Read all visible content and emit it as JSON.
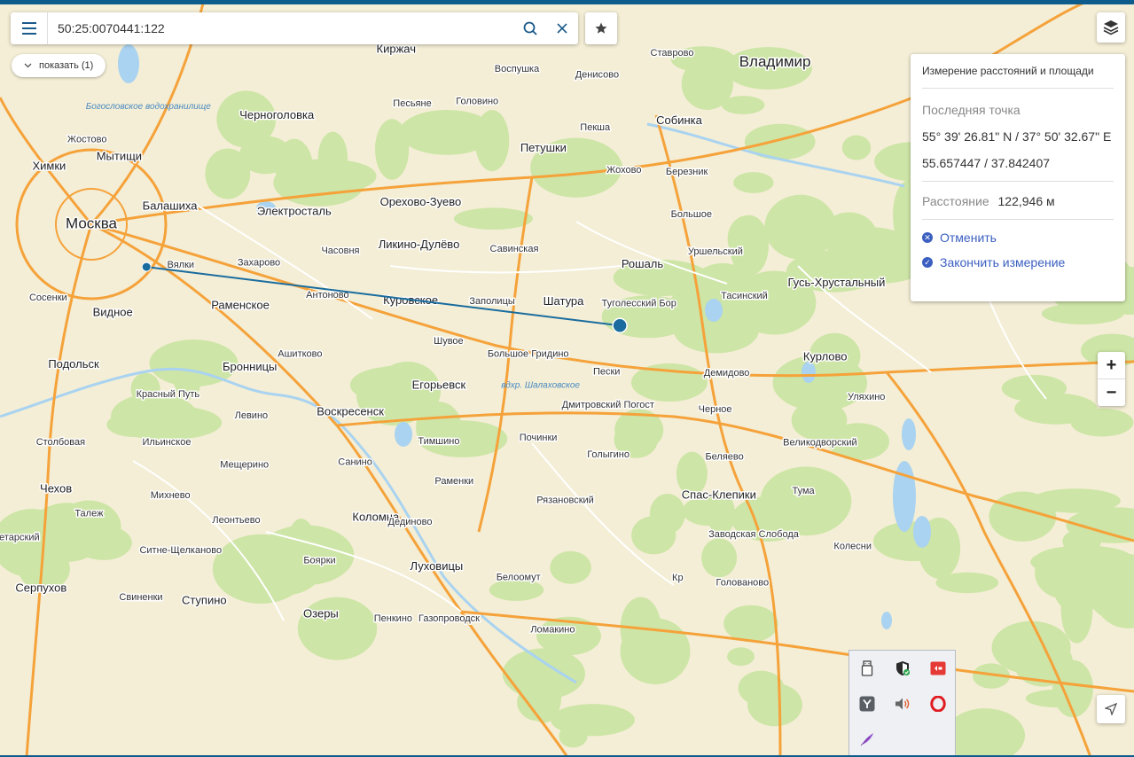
{
  "search": {
    "value": "50:25:0070441:122"
  },
  "show_button": {
    "label": "показать (1)"
  },
  "measure_panel": {
    "title": "Измерение расстояний и площади",
    "last_point_label": "Последняя точка",
    "coords_dms": "55° 39' 26.81\" N / 37° 50' 32.67\" E",
    "coords_decimal": "55.657447 / 37.842407",
    "distance_label": "Расстояние",
    "distance_value": "122,946 м",
    "cancel_label": "Отменить",
    "finish_label": "Закончить измерение"
  },
  "zoom": {
    "plus": "+",
    "minus": "−"
  },
  "map": {
    "colors": {
      "land": "#f4eed6",
      "forest": "#cde5a6",
      "water": "#a9d3f0",
      "road_major": "#f5a23a",
      "road_minor": "#ffffff",
      "measure_line": "#1a6c9e"
    },
    "cities_major": [
      {
        "name": "Москва",
        "lat": 55.7558,
        "lon": 37.6173
      },
      {
        "name": "Владимир",
        "lat": 56.129,
        "lon": 40.407
      }
    ],
    "cities": [
      {
        "name": "Химки",
        "lat": 55.889,
        "lon": 37.445
      },
      {
        "name": "Мытищи",
        "lat": 55.911,
        "lon": 37.731
      },
      {
        "name": "Балашиха",
        "lat": 55.796,
        "lon": 37.938
      },
      {
        "name": "Электросталь",
        "lat": 55.784,
        "lon": 38.445
      },
      {
        "name": "Черноголовка",
        "lat": 56.006,
        "lon": 38.374
      },
      {
        "name": "Орехово-Зуево",
        "lat": 55.806,
        "lon": 38.961
      },
      {
        "name": "Ликино-Дулёво",
        "lat": 55.708,
        "lon": 38.954
      },
      {
        "name": "Петушки",
        "lat": 55.93,
        "lon": 39.462
      },
      {
        "name": "Собинка",
        "lat": 55.994,
        "lon": 40.016
      },
      {
        "name": "Рошаль",
        "lat": 55.663,
        "lon": 39.866
      },
      {
        "name": "Гусь-Хрустальный",
        "lat": 55.62,
        "lon": 40.658
      },
      {
        "name": "Раменское",
        "lat": 55.567,
        "lon": 38.225
      },
      {
        "name": "Видное",
        "lat": 55.551,
        "lon": 37.705
      },
      {
        "name": "Куровское",
        "lat": 55.579,
        "lon": 38.92
      },
      {
        "name": "Шатура",
        "lat": 55.577,
        "lon": 39.544
      },
      {
        "name": "Подольск",
        "lat": 55.431,
        "lon": 37.545
      },
      {
        "name": "Бронницы",
        "lat": 55.425,
        "lon": 38.264
      },
      {
        "name": "Егорьевск",
        "lat": 55.383,
        "lon": 39.035
      },
      {
        "name": "Курлово",
        "lat": 55.449,
        "lon": 40.612
      },
      {
        "name": "Воскресенск",
        "lat": 55.322,
        "lon": 38.674
      },
      {
        "name": "Чехов",
        "lat": 55.144,
        "lon": 37.473
      },
      {
        "name": "Спас-Клепики",
        "lat": 55.13,
        "lon": 40.178
      },
      {
        "name": "Коломна",
        "lat": 55.079,
        "lon": 38.778
      },
      {
        "name": "Серпухов",
        "lat": 54.915,
        "lon": 37.412
      },
      {
        "name": "Луховицы",
        "lat": 54.965,
        "lon": 39.026
      },
      {
        "name": "Ступино",
        "lat": 54.886,
        "lon": 38.078
      },
      {
        "name": "Озеры",
        "lat": 54.856,
        "lon": 38.554
      },
      {
        "name": "Киржач",
        "lat": 56.158,
        "lon": 38.861
      }
    ],
    "villages": [
      {
        "name": "Жостово",
        "lat": 55.951,
        "lon": 37.6
      },
      {
        "name": "Песьяне",
        "lat": 56.034,
        "lon": 38.927
      },
      {
        "name": "Головино",
        "lat": 56.039,
        "lon": 39.192
      },
      {
        "name": "Воспушка",
        "lat": 56.113,
        "lon": 39.354
      },
      {
        "name": "Денисово",
        "lat": 56.1,
        "lon": 39.681
      },
      {
        "name": "Ставрово",
        "lat": 56.15,
        "lon": 39.987
      },
      {
        "name": "Пекша",
        "lat": 55.978,
        "lon": 39.673
      },
      {
        "name": "Жохово",
        "lat": 55.88,
        "lon": 39.791
      },
      {
        "name": "Березник",
        "lat": 55.876,
        "lon": 40.047
      },
      {
        "name": "Большое",
        "lat": 55.778,
        "lon": 40.066
      },
      {
        "name": "Часовня",
        "lat": 55.694,
        "lon": 38.634
      },
      {
        "name": "Савинская",
        "lat": 55.698,
        "lon": 39.343
      },
      {
        "name": "Вялки",
        "lat": 55.662,
        "lon": 37.982
      },
      {
        "name": "Захарово",
        "lat": 55.667,
        "lon": 38.301
      },
      {
        "name": "Сосенки",
        "lat": 55.586,
        "lon": 37.441
      },
      {
        "name": "Антоново",
        "lat": 55.592,
        "lon": 38.581
      },
      {
        "name": "Заполицы",
        "lat": 55.578,
        "lon": 39.253
      },
      {
        "name": "Туголесский Бор",
        "lat": 55.573,
        "lon": 39.852
      },
      {
        "name": "Тасинский",
        "lat": 55.59,
        "lon": 40.282
      },
      {
        "name": "Шувое",
        "lat": 55.486,
        "lon": 39.075
      },
      {
        "name": "Ашитково",
        "lat": 55.456,
        "lon": 38.469
      },
      {
        "name": "Большое Гридино",
        "lat": 55.456,
        "lon": 39.4
      },
      {
        "name": "Пески",
        "lat": 55.415,
        "lon": 39.72
      },
      {
        "name": "Демидово",
        "lat": 55.412,
        "lon": 40.21
      },
      {
        "name": "Красный Путь",
        "lat": 55.363,
        "lon": 37.93
      },
      {
        "name": "Дмитровский Погост",
        "lat": 55.338,
        "lon": 39.726
      },
      {
        "name": "Черное",
        "lat": 55.328,
        "lon": 40.163
      },
      {
        "name": "Уляхино",
        "lat": 55.357,
        "lon": 40.78
      },
      {
        "name": "Левино",
        "lat": 55.314,
        "lon": 38.27
      },
      {
        "name": "Тимшино",
        "lat": 55.255,
        "lon": 39.035
      },
      {
        "name": "Починки",
        "lat": 55.263,
        "lon": 39.441
      },
      {
        "name": "Столбовая",
        "lat": 55.253,
        "lon": 37.492
      },
      {
        "name": "Ильинское",
        "lat": 55.253,
        "lon": 37.925
      },
      {
        "name": "Голыгино",
        "lat": 55.224,
        "lon": 39.727
      },
      {
        "name": "Беляево",
        "lat": 55.219,
        "lon": 40.201
      },
      {
        "name": "Великодворский",
        "lat": 55.251,
        "lon": 40.591
      },
      {
        "name": "Мещерино",
        "lat": 55.2,
        "lon": 38.242
      },
      {
        "name": "Санино",
        "lat": 55.207,
        "lon": 38.694
      },
      {
        "name": "Раменки",
        "lat": 55.163,
        "lon": 39.098
      },
      {
        "name": "Рязановский",
        "lat": 55.119,
        "lon": 39.551
      },
      {
        "name": "Тума",
        "lat": 55.14,
        "lon": 40.523
      },
      {
        "name": "Михнево",
        "lat": 55.13,
        "lon": 37.94
      },
      {
        "name": "Талеж",
        "lat": 55.088,
        "lon": 37.608
      },
      {
        "name": "Леонтьево",
        "lat": 55.073,
        "lon": 38.209
      },
      {
        "name": "Дединово",
        "lat": 55.068,
        "lon": 38.918
      },
      {
        "name": "Заводская Слобода",
        "lat": 55.04,
        "lon": 40.32
      },
      {
        "name": "Колесни",
        "lat": 55.012,
        "lon": 40.724
      },
      {
        "name": "Ситне-Щелканово",
        "lat": 55.003,
        "lon": 37.982
      },
      {
        "name": "Боярки",
        "lat": 54.98,
        "lon": 38.549
      },
      {
        "name": "Белоомут",
        "lat": 54.941,
        "lon": 39.36
      },
      {
        "name": "Голованово",
        "lat": 54.928,
        "lon": 40.274
      },
      {
        "name": "Свиненки",
        "lat": 54.895,
        "lon": 37.82
      },
      {
        "name": "Пенкино",
        "lat": 54.846,
        "lon": 38.849
      },
      {
        "name": "Газопроводск",
        "lat": 54.846,
        "lon": 39.077
      },
      {
        "name": "Пролетарский",
        "lat": 55.033,
        "lon": 37.276
      },
      {
        "name": "Уршельский",
        "lat": 55.692,
        "lon": 40.164
      },
      {
        "name": "Ломакино",
        "lat": 54.82,
        "lon": 39.5
      },
      {
        "name": "Кр",
        "lat": 54.94,
        "lon": 40.01
      }
    ],
    "water_labels": [
      {
        "name": "Богословское водохранилище",
        "lat": 56.022,
        "lon": 37.85
      },
      {
        "name": "вдхр. Шалаховское",
        "lat": 55.378,
        "lon": 39.45
      }
    ],
    "measure": {
      "start": {
        "lat": 55.657447,
        "lon": 37.842407
      },
      "end": {
        "lat": 55.522,
        "lon": 39.774
      }
    }
  }
}
